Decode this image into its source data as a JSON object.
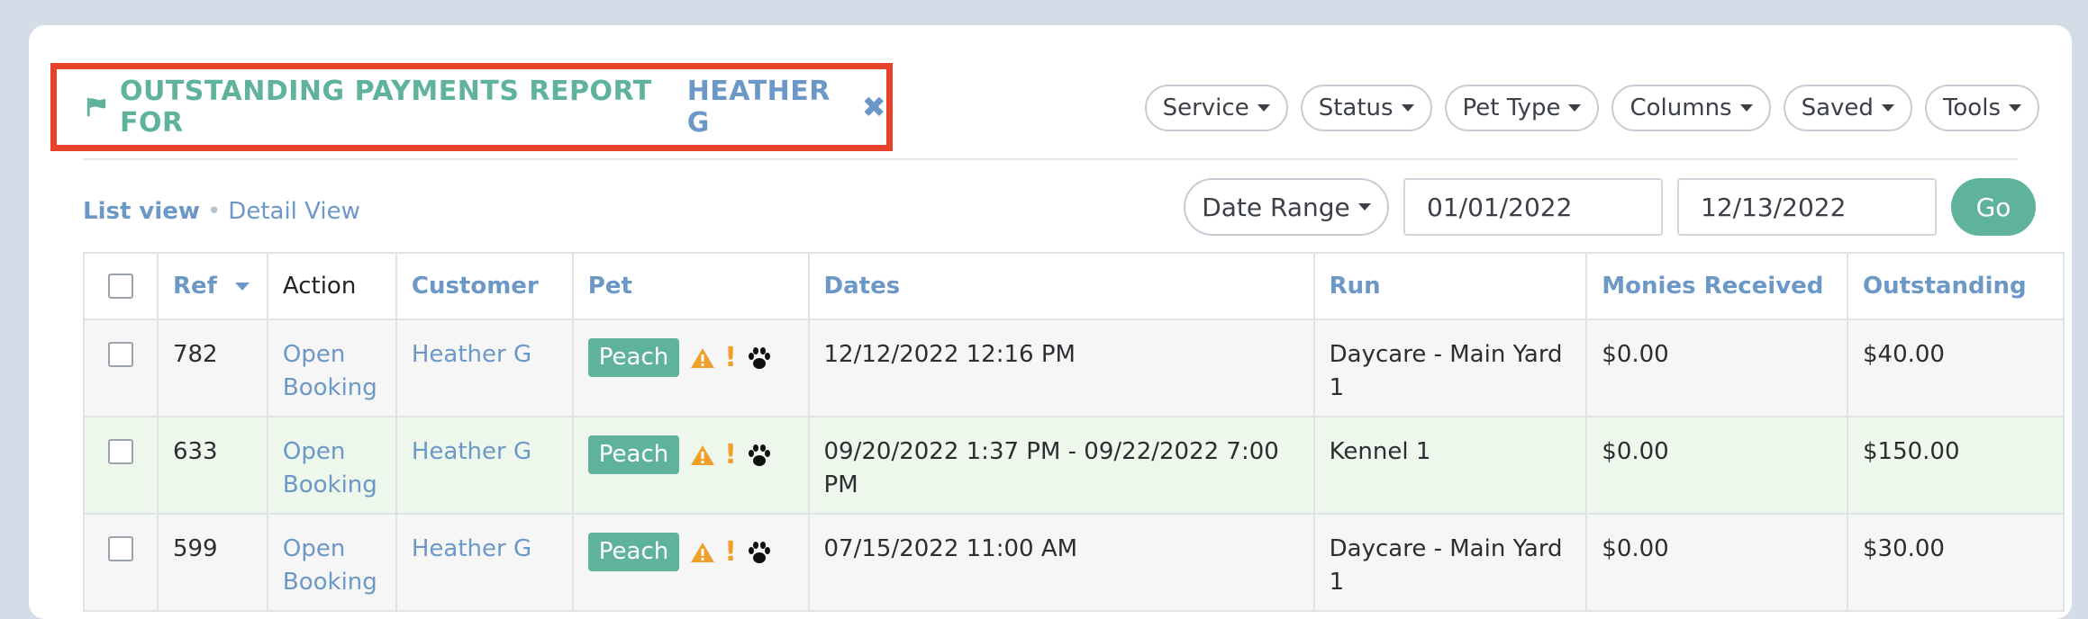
{
  "report": {
    "title_prefix": "OUTSTANDING PAYMENTS REPORT FOR",
    "customer_name": "HEATHER G",
    "close_symbol": "✖"
  },
  "toolbar": {
    "buttons": [
      "Service",
      "Status",
      "Pet Type",
      "Columns",
      "Saved",
      "Tools"
    ]
  },
  "views": {
    "list": "List view",
    "separator": "•",
    "detail": "Detail View"
  },
  "date_filter": {
    "range_label": "Date Range",
    "start": "01/01/2022",
    "end": "12/13/2022",
    "go_label": "Go"
  },
  "table": {
    "headers": {
      "ref": "Ref",
      "action": "Action",
      "customer": "Customer",
      "pet": "Pet",
      "dates": "Dates",
      "run": "Run",
      "monies": "Monies Received",
      "outstanding": "Outstanding"
    },
    "rows": [
      {
        "ref": "782",
        "action": "Open Booking",
        "customer": "Heather G",
        "pet": "Peach",
        "dates": "12/12/2022 12:16 PM",
        "run": "Daycare - Main Yard 1",
        "monies": "$0.00",
        "outstanding": "$40.00"
      },
      {
        "ref": "633",
        "action": "Open Booking",
        "customer": "Heather G",
        "pet": "Peach",
        "dates": "09/20/2022 1:37 PM - 09/22/2022 7:00 PM",
        "run": "Kennel 1",
        "monies": "$0.00",
        "outstanding": "$150.00"
      },
      {
        "ref": "599",
        "action": "Open Booking",
        "customer": "Heather G",
        "pet": "Peach",
        "dates": "07/15/2022 11:00 AM",
        "run": "Daycare - Main Yard 1",
        "monies": "$0.00",
        "outstanding": "$30.00"
      }
    ]
  },
  "icons": {
    "flag": "flag-icon",
    "warning": "warning-icon",
    "alert": "exclamation-icon",
    "paw": "paw-icon"
  },
  "colors": {
    "accent_green": "#5fb39d",
    "link_blue": "#6c98c8",
    "highlight_border": "#e8432a",
    "warning_orange": "#f0a02a"
  }
}
